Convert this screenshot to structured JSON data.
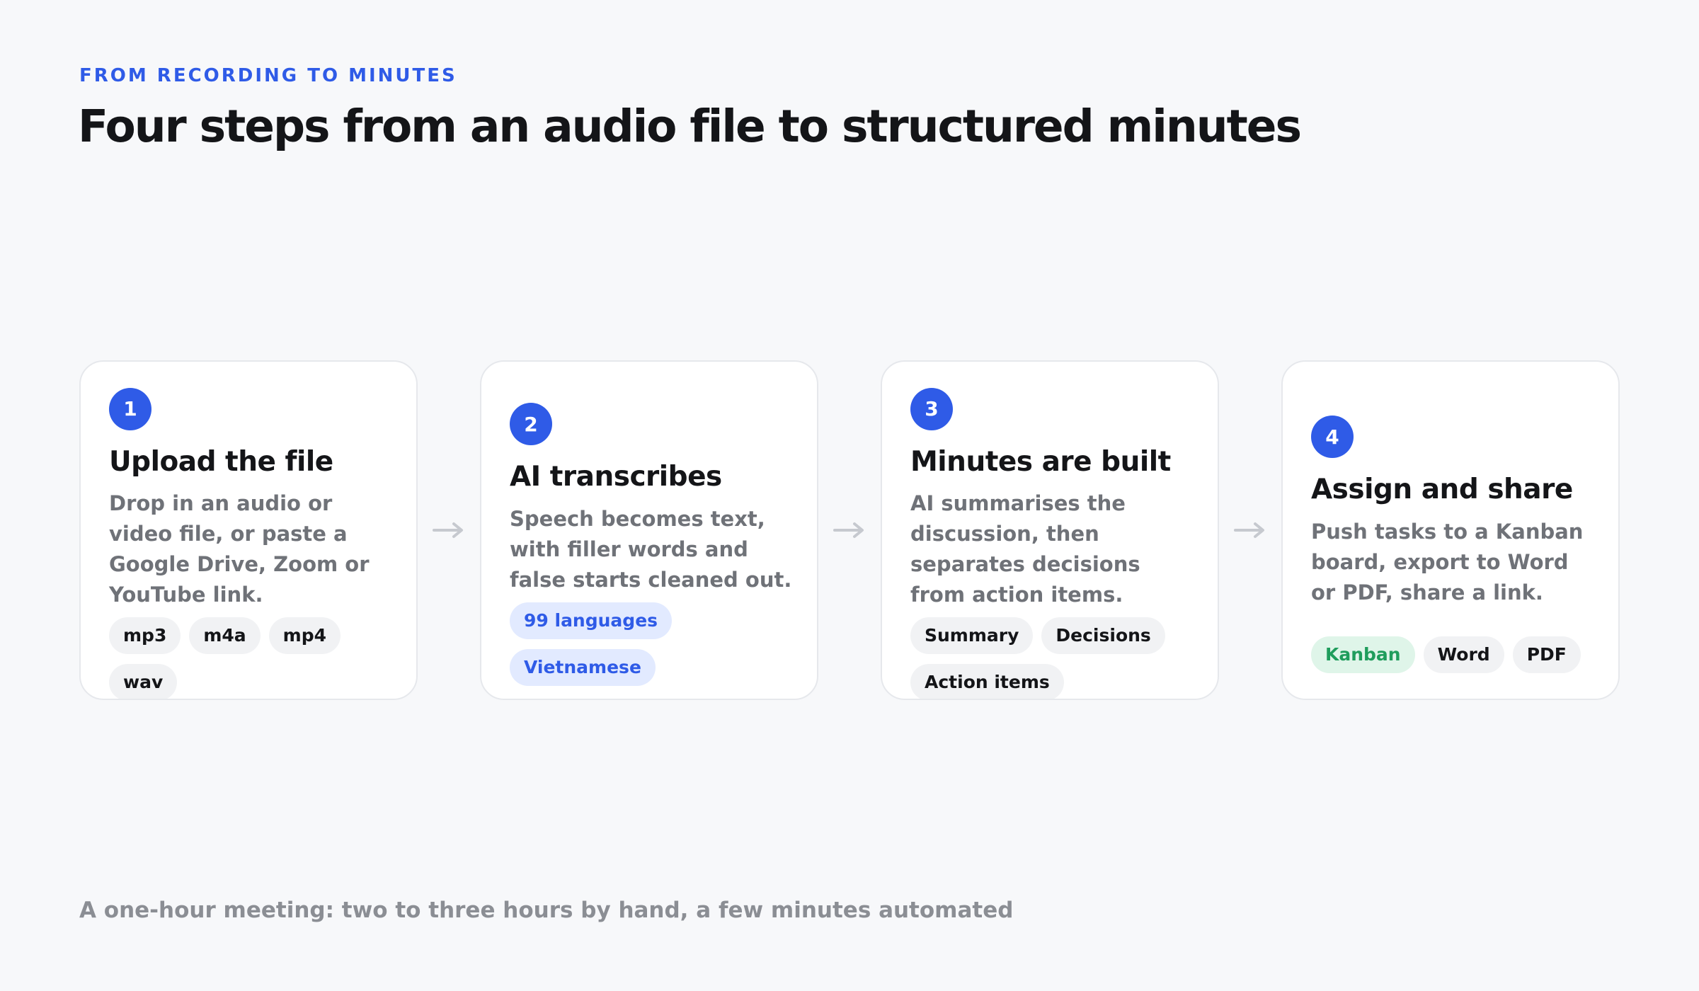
{
  "header": {
    "eyebrow": "FROM RECORDING TO MINUTES",
    "title": "Four steps from an audio file to structured minutes"
  },
  "colors": {
    "accent": "#2f5be7",
    "heading": "#141518",
    "muted": "#6f7278",
    "chip_blue_bg": "#e2eaff",
    "chip_green_bg": "#dff5e9",
    "chip_green_text": "#1f9d5c",
    "arrow": "#c6c9cf"
  },
  "steps": [
    {
      "number": "1",
      "title": "Upload the file",
      "description": "Drop in an audio or video file, or paste a Google Drive, Zoom or YouTube link.",
      "chips": [
        "mp3",
        "m4a",
        "mp4",
        "wav"
      ]
    },
    {
      "number": "2",
      "title": "AI transcribes",
      "description": "Speech becomes text, with filler words and false starts cleaned out.",
      "chips": [
        "99 languages",
        "Vietnamese"
      ]
    },
    {
      "number": "3",
      "title": "Minutes are built",
      "description": "AI summarises the discussion, then separates decisions from action items.",
      "chips": [
        "Summary",
        "Decisions",
        "Action items"
      ]
    },
    {
      "number": "4",
      "title": "Assign and share",
      "description": "Push tasks to a Kanban board, export to Word or PDF, share a link.",
      "chips": [
        "Kanban",
        "Word",
        "PDF"
      ]
    }
  ],
  "arrow_icon": "arrow-right-icon",
  "footer": {
    "note": "A one-hour meeting: two to three hours by hand, a few minutes automated"
  }
}
